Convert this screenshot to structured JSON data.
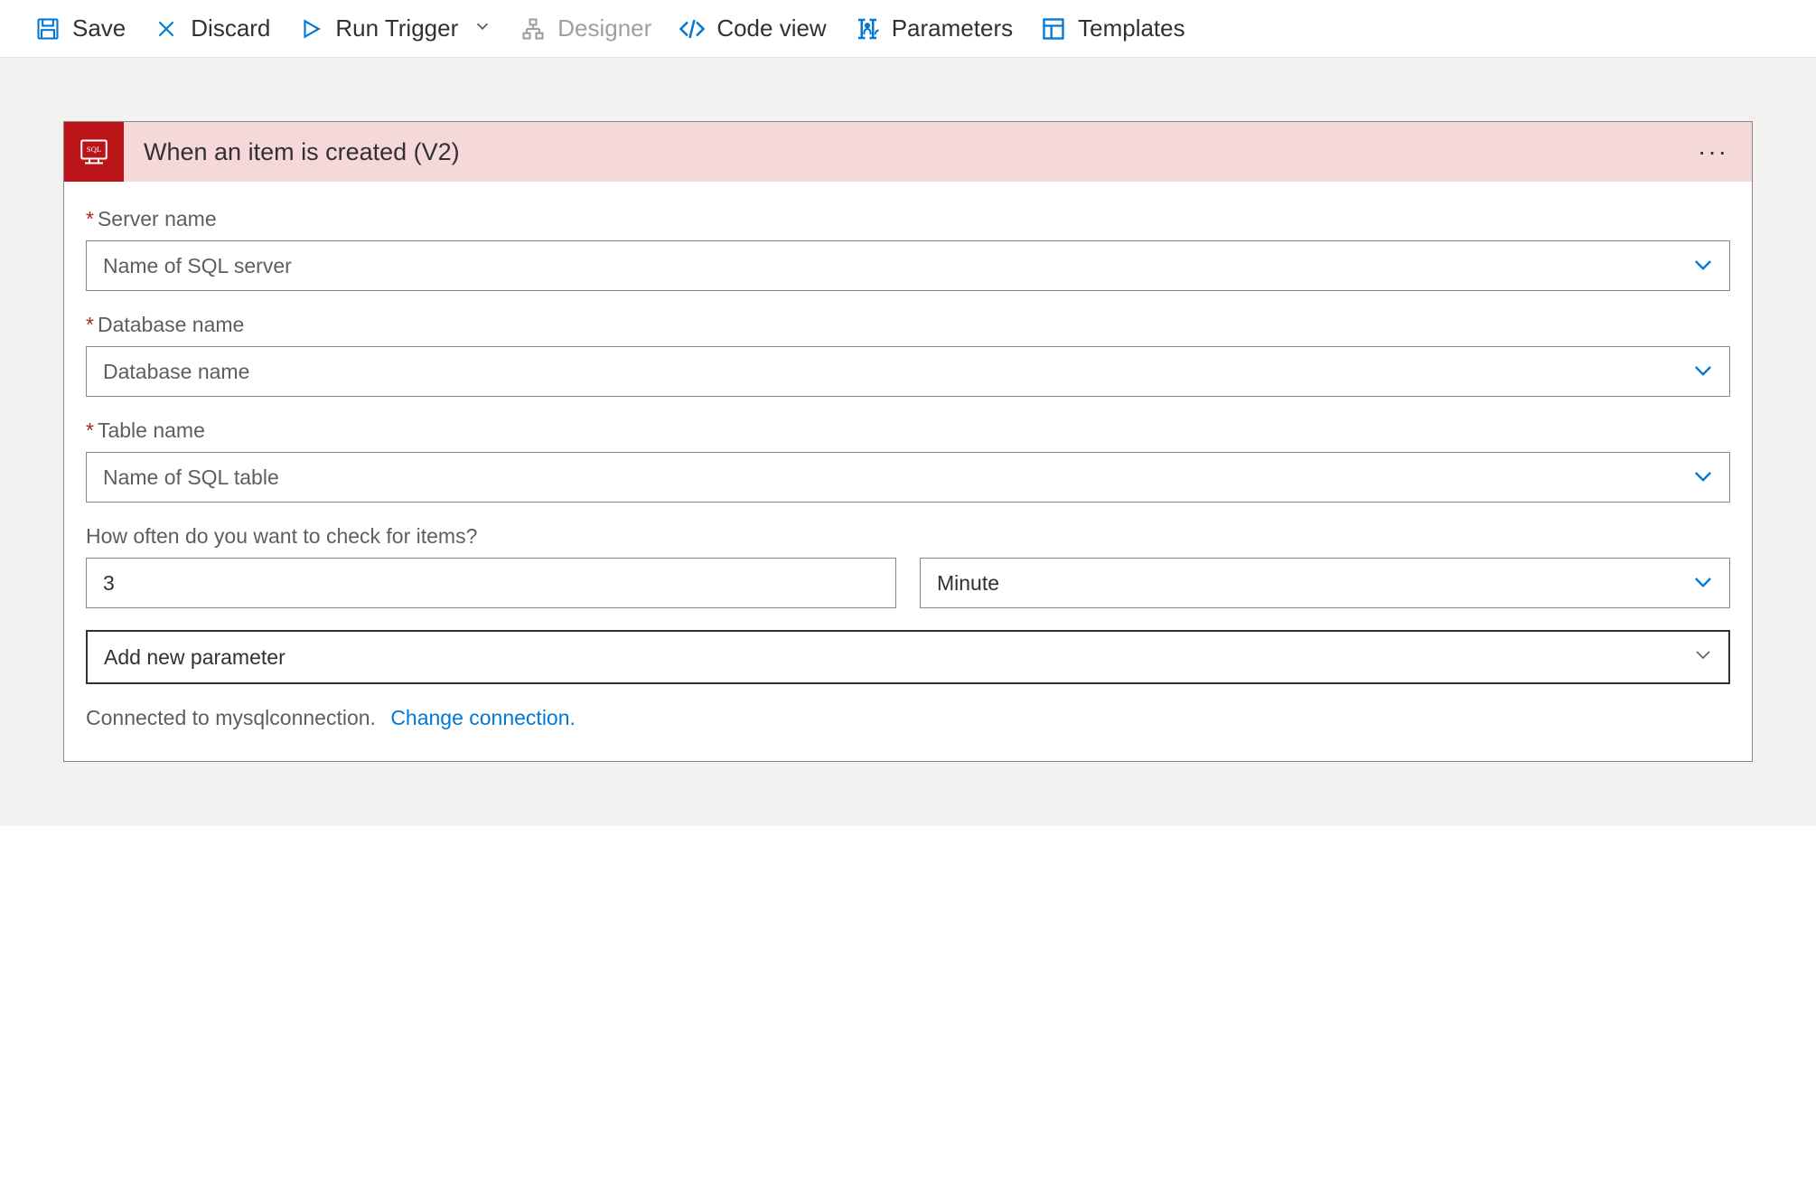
{
  "toolbar": {
    "save": "Save",
    "discard": "Discard",
    "runTrigger": "Run Trigger",
    "designer": "Designer",
    "codeView": "Code view",
    "parameters": "Parameters",
    "templates": "Templates"
  },
  "card": {
    "title": "When an item is created (V2)"
  },
  "fields": {
    "serverName": {
      "label": "Server name",
      "placeholder": "Name of SQL server"
    },
    "databaseName": {
      "label": "Database name",
      "placeholder": "Database name"
    },
    "tableName": {
      "label": "Table name",
      "placeholder": "Name of SQL table"
    },
    "frequency": {
      "label": "How often do you want to check for items?",
      "intervalValue": "3",
      "unit": "Minute"
    },
    "addParam": "Add new parameter"
  },
  "connection": {
    "text": "Connected to mysqlconnection.",
    "changeLink": "Change connection."
  }
}
